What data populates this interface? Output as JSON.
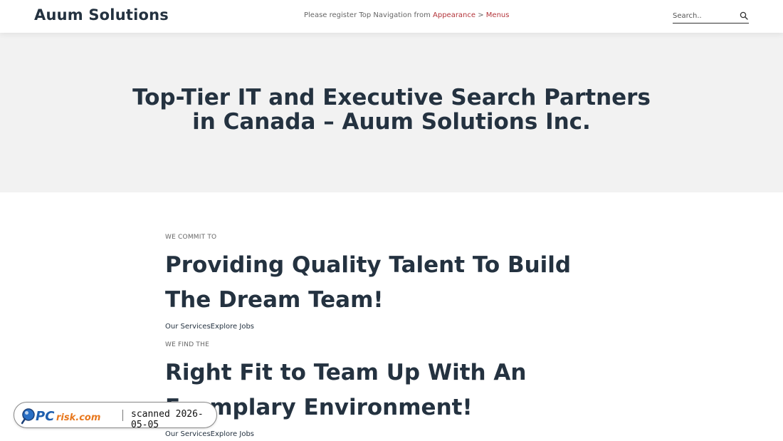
{
  "header": {
    "logo": "Auum Solutions",
    "nav_notice_prefix": "Please register Top Navigation from ",
    "nav_link_appearance": "Appearance",
    "nav_separator": " > ",
    "nav_link_menus": "Menus",
    "search_placeholder": "Search.."
  },
  "hero": {
    "title_line1": "Top-Tier IT and Executive Search Partners",
    "title_line2": "in Canada – Auum Solutions Inc."
  },
  "sections": [
    {
      "eyebrow": "WE COMMIT TO",
      "heading": "Providing Quality Talent To Build The Dream Team!",
      "link_services": "Our Services",
      "link_jobs": "Explore Jobs"
    },
    {
      "eyebrow": "WE FIND THE",
      "heading": "Right Fit to Team Up With An Exemplary Environment!",
      "link_services": "Our Services",
      "link_jobs": "Explore Jobs"
    }
  ],
  "watermark": {
    "brand": "PCrisk.com",
    "text": "scanned 2026-05-05"
  },
  "colors": {
    "text_dark": "#243240",
    "link_accent": "#b3343a",
    "hero_bg": "#f2f2f2"
  }
}
